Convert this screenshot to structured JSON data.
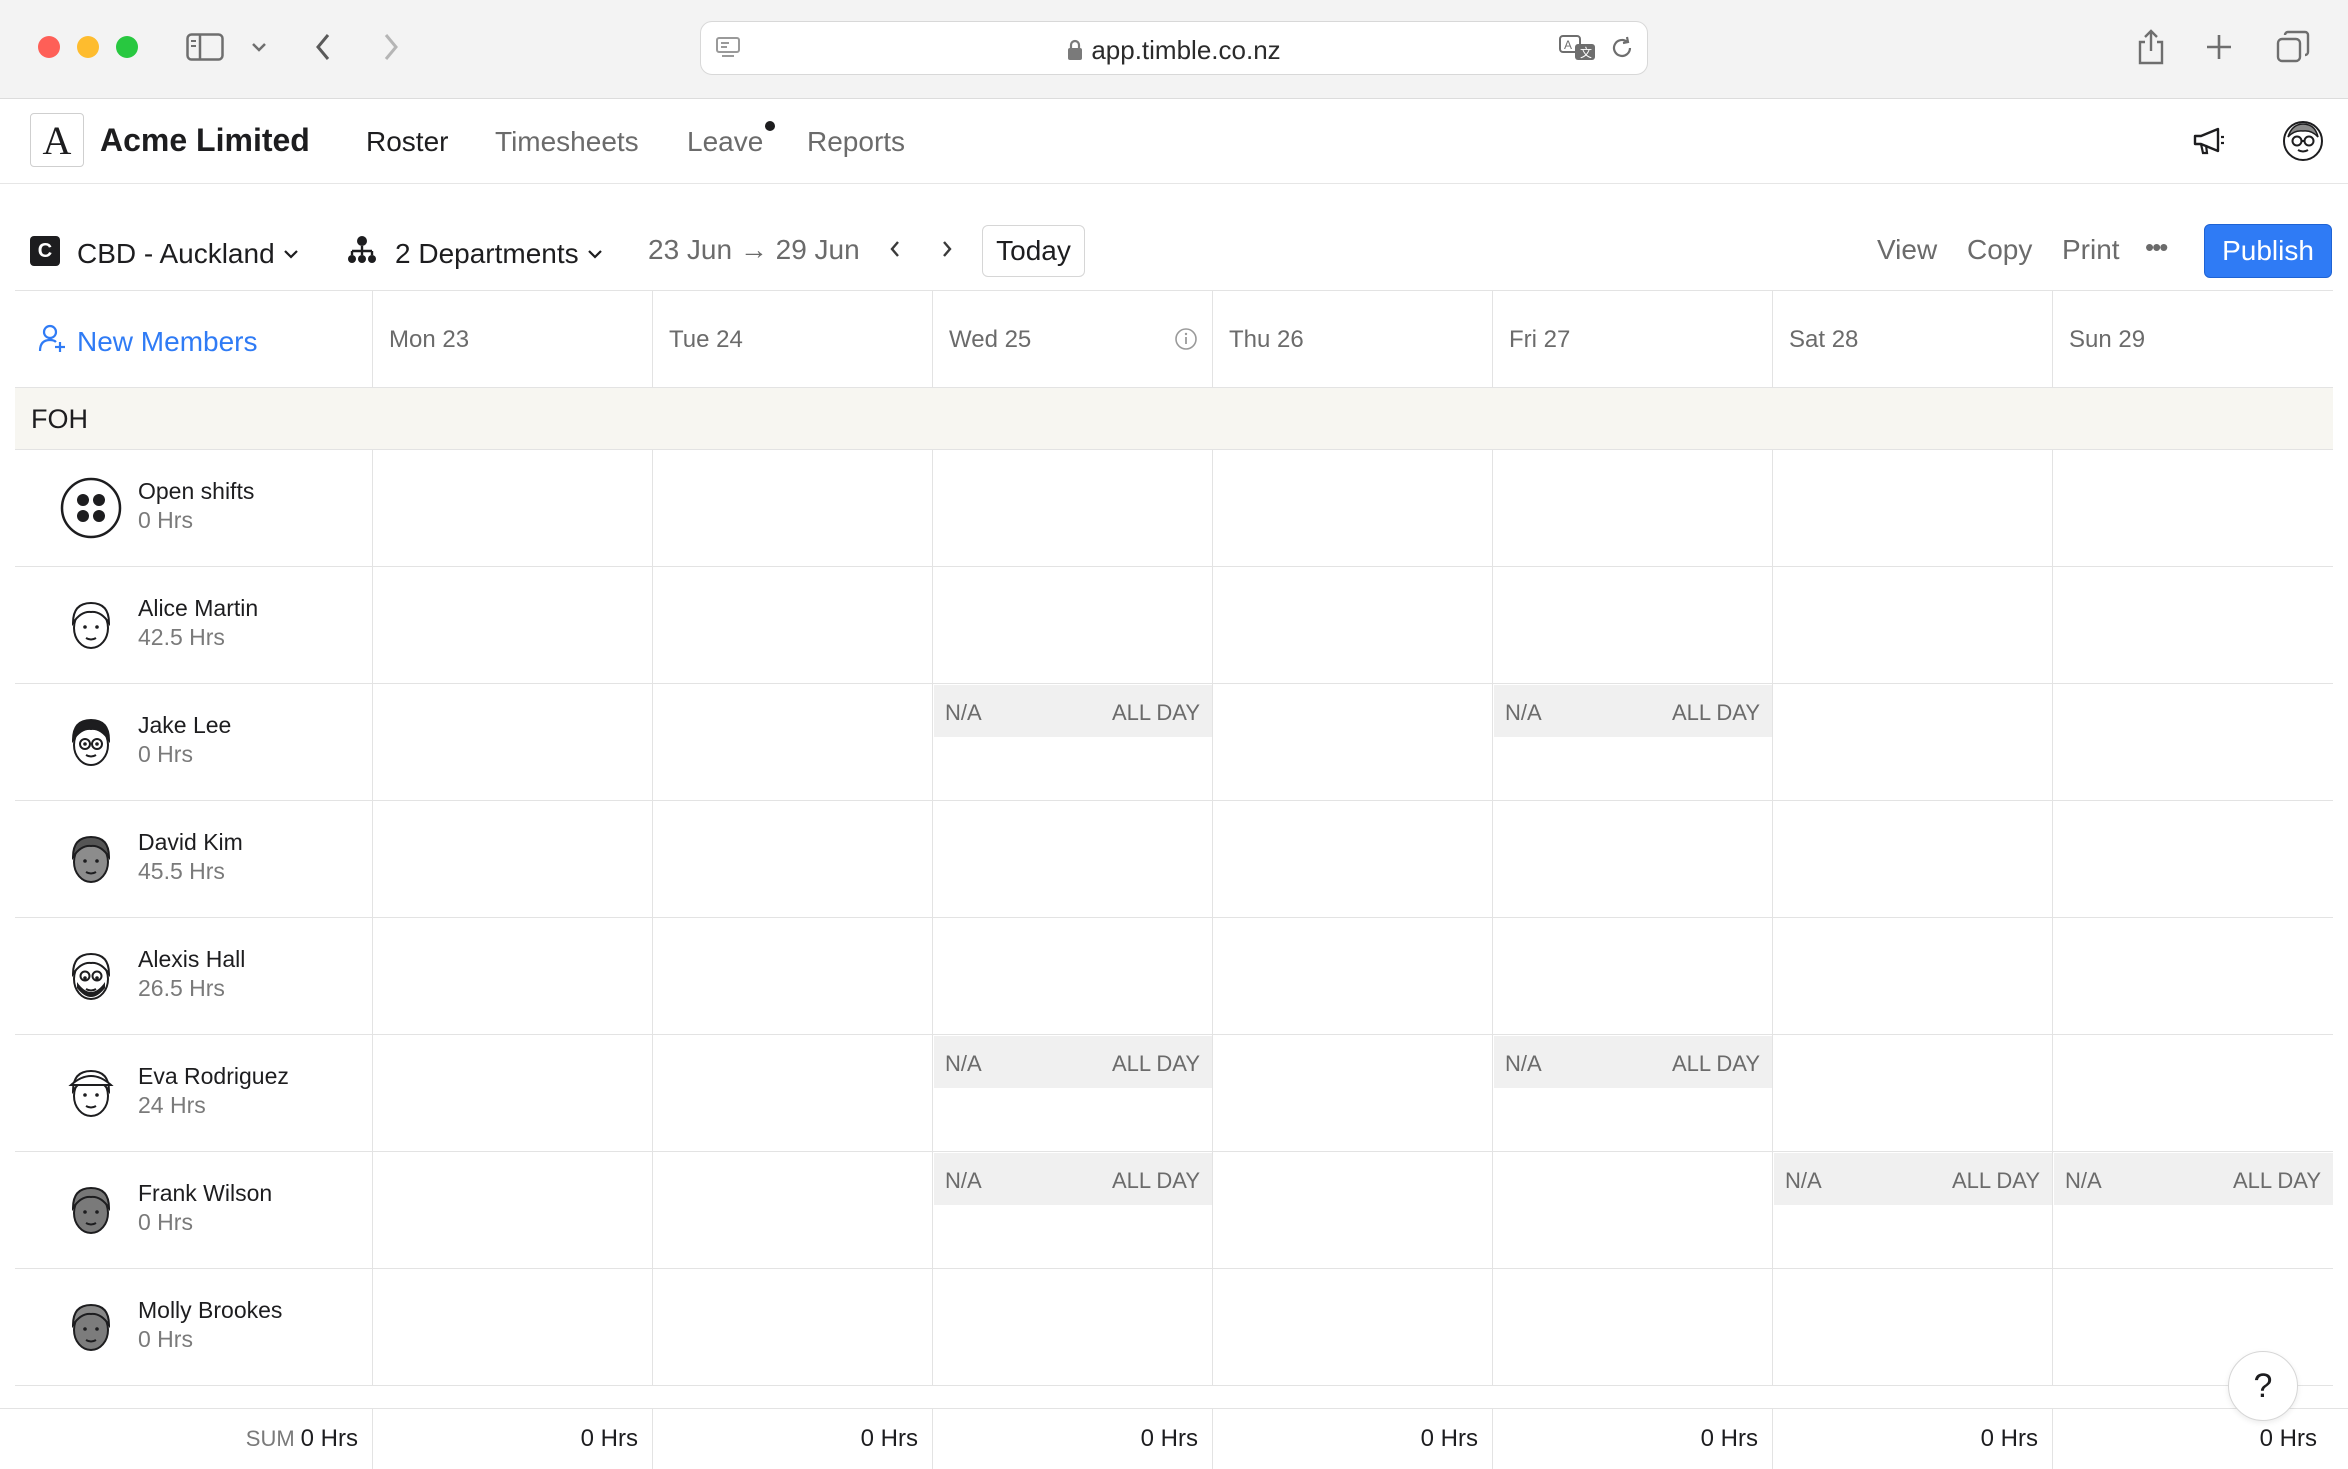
{
  "browser": {
    "url": "app.timble.co.nz"
  },
  "app": {
    "logo_letter": "A",
    "company": "Acme Limited",
    "nav": [
      {
        "label": "Roster"
      },
      {
        "label": "Timesheets"
      },
      {
        "label": "Leave"
      },
      {
        "label": "Reports"
      }
    ]
  },
  "toolbar": {
    "location_badge": "C",
    "location": "CBD - Auckland",
    "departments": "2 Departments",
    "date_range": "23 Jun → 29 Jun",
    "today_label": "Today",
    "view_label": "View",
    "copy_label": "Copy",
    "print_label": "Print",
    "more_label": "•••",
    "publish_label": "Publish"
  },
  "grid": {
    "new_members_label": "New Members",
    "days": [
      "Mon 23",
      "Tue 24",
      "Wed 25",
      "Thu 26",
      "Fri 27",
      "Sat 28",
      "Sun 29"
    ],
    "section": "FOH",
    "na_label": "N/A",
    "all_day_label": "ALL DAY",
    "rows": [
      {
        "name": "Open shifts",
        "hours": "0 Hrs"
      },
      {
        "name": "Alice Martin",
        "hours": "42.5 Hrs"
      },
      {
        "name": "Jake Lee",
        "hours": "0 Hrs"
      },
      {
        "name": "David Kim",
        "hours": "45.5 Hrs"
      },
      {
        "name": "Alexis Hall",
        "hours": "26.5 Hrs"
      },
      {
        "name": "Eva Rodriguez",
        "hours": "24 Hrs"
      },
      {
        "name": "Frank Wilson",
        "hours": "0 Hrs"
      },
      {
        "name": "Molly Brookes",
        "hours": "0 Hrs"
      }
    ]
  },
  "footer": {
    "sum_label": "SUM",
    "total": "0 Hrs",
    "daily": [
      "0 Hrs",
      "0 Hrs",
      "0 Hrs",
      "0 Hrs",
      "0 Hrs",
      "0 Hrs",
      "0 Hrs"
    ]
  },
  "help_label": "?",
  "colors": {
    "accent": "#2f7bf5",
    "section_bg": "#f7f6f1",
    "na_bg": "#f0f0f0"
  }
}
